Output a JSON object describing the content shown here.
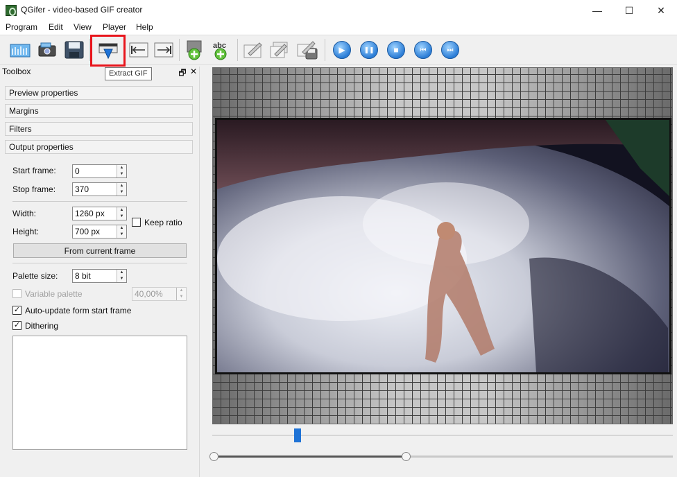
{
  "window": {
    "title": "QGifer - video-based GIF creator",
    "minimize": "—",
    "maximize": "☐",
    "close": "✕"
  },
  "menu": [
    "Program",
    "Edit",
    "View",
    "Player",
    "Help"
  ],
  "tooltip": "Extract GIF",
  "toolbox": {
    "title": "Toolbox",
    "float_glyph": "🗗",
    "close_glyph": "✕",
    "sections": [
      "Preview properties",
      "Margins",
      "Filters",
      "Output properties"
    ],
    "start_frame": {
      "label": "Start frame:",
      "value": "0"
    },
    "stop_frame": {
      "label": "Stop frame:",
      "value": "370"
    },
    "width": {
      "label": "Width:",
      "value": "1260 px"
    },
    "height": {
      "label": "Height:",
      "value": "700 px"
    },
    "keep_ratio": {
      "label": "Keep ratio",
      "checked": false
    },
    "from_current_frame": "From current frame",
    "palette_size": {
      "label": "Palette size:",
      "value": "8 bit"
    },
    "variable_palette": {
      "label": "Variable palette",
      "value": "40,00%",
      "enabled": false,
      "checked": false
    },
    "auto_update": {
      "label": "Auto-update form start frame",
      "checked": true
    },
    "dithering": {
      "label": "Dithering",
      "checked": true
    },
    "check_glyph": "✓",
    "spin_glyph": "▲\n▼"
  },
  "toolbar_icons": [
    "open-video-icon",
    "open-gif-icon",
    "save-icon",
    "extract-gif-icon",
    "set-start-icon",
    "set-stop-icon",
    "add-object-icon",
    "add-text-icon",
    "edit-icon",
    "edit-multi-icon",
    "save-frame-icon",
    "play-icon",
    "pause-icon",
    "stop-icon",
    "prev-frame-icon",
    "next-frame-icon"
  ],
  "player_glyphs": {
    "play": "▶",
    "pause": "❚❚",
    "stop": "■",
    "prev": "⏮",
    "next": "⏭"
  },
  "colors": {
    "accent_blue": "#1f73d6",
    "highlight_red": "#e8141b"
  },
  "timeline": {
    "position_fraction": 0.18,
    "range_start_fraction": 0.0,
    "range_end_fraction": 0.42
  }
}
